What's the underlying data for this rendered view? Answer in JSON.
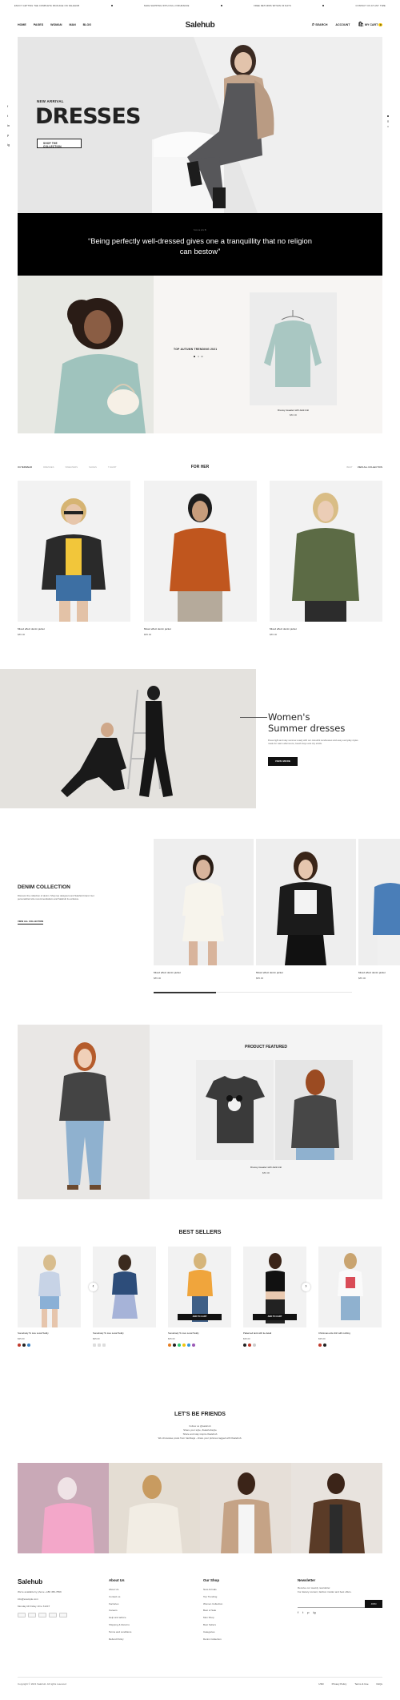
{
  "ticker": [
    "ENJOY GETTING THE COMPLETE PACKAGE ON SALEHUB",
    "SAFE SHIPPING WITH FULL INSURANCE",
    "FREE RETURNS WITHIN 30 DAYS",
    "CONTACT US AT ANY TIME"
  ],
  "header": {
    "logo": "Salehub",
    "menu": [
      "HOME",
      "PAGES",
      "WOMAN",
      "MAN",
      "BLOG"
    ],
    "search": "SEARCH",
    "account": "ACCOUNT",
    "cart": "MY CART",
    "cart_count": "0"
  },
  "social_icons": [
    "f",
    "t",
    "in",
    "p",
    "ig"
  ],
  "hero": {
    "subtitle": "NEW ARRIVAL",
    "title": "DRESSES",
    "button": "SHOP THE COLLECTION"
  },
  "quote": {
    "label": "SALEHUB",
    "text": "“Being perfectly well-dressed gives one a tranquillity that no religion can bestow”"
  },
  "trending": {
    "caption": "TOP AUTUMN TRENDING 2021",
    "product_name": "Dressy sweater with dark knit",
    "product_price": "$80.00"
  },
  "for_her": {
    "title": "FOR HER",
    "tabs": [
      "OUTERWEAR",
      "DRESSES",
      "SWEATERS",
      "SHOES",
      "T-SHIRT"
    ],
    "right_links": [
      "BEST",
      "VIEW ALL COLLECTION"
    ],
    "products": [
      {
        "name": "Mixed effect denim jacket",
        "price": "$85.00"
      },
      {
        "name": "Mixed effect denim jacket",
        "price": "$85.00"
      },
      {
        "name": "Mixed effect denim jacket",
        "price": "$85.00"
      }
    ]
  },
  "summer": {
    "title_line1": "Women's",
    "title_line2": "Summer dresses",
    "description": "Dress light and stay summer-ready with our colourful sundresses and easy everyday styles made for warm afternoons, beach days and city strolls.",
    "button": "VIEW MORE"
  },
  "denim": {
    "title": "DENIM COLLECTION",
    "description": "Discover the collection of denim. Shop top designers and Salehub brand. Get personalized size recommendations and Salehub & exclusive.",
    "link": "VIEW ALL COLLECTION",
    "products": [
      {
        "name": "Mixed effect denim jacket",
        "price": "$85.00"
      },
      {
        "name": "Mixed effect denim jacket",
        "price": "$85.00"
      },
      {
        "name": "Mixed effect denim jacket",
        "price": "$85.00"
      }
    ]
  },
  "featured": {
    "title": "PRODUCT FEATURED",
    "product_name": "Dressy sweater with dark knit",
    "product_price": "$80.00"
  },
  "best_sellers": {
    "title": "BEST SELLERS",
    "add_to_cart": "ADD TO CART",
    "products": [
      {
        "name": "Somebody To Live Local Teddy",
        "price": "$35.00"
      },
      {
        "name": "Somebody To Live Local Teddy",
        "price": "$35.00"
      },
      {
        "name": "Somebody To Live Local Teddy",
        "price": "$35.00"
      },
      {
        "name": "Patterned tank with tie detail",
        "price": "$35.00"
      },
      {
        "name": "Christmas arts shirt with nothing",
        "price": "$35.00"
      }
    ]
  },
  "friends": {
    "title": "LET'S BE FRIENDS",
    "lines": [
      "Follow us @salehub",
      "Share your style, #salehubstyle",
      "Share and stay inspire #salehub",
      "We showcase posts from hashtags - share your pictures tagged with #salehub."
    ]
  },
  "footer": {
    "logo": "Salehub",
    "contact": [
      "We're available by phone +180 456-7899",
      "info@example.com",
      "Monday till Friday 10 to 6 EST"
    ],
    "about_title": "About Us",
    "about_links": [
      "About Us",
      "Contact us",
      "Factories",
      "Careers",
      "Help and advice",
      "Shipping & Returns",
      "Terms and conditions",
      "Refund Policy"
    ],
    "shop_title": "Our Shop",
    "shop_links": [
      "New Arrivals",
      "Top Trending",
      "Women Collection",
      "Best of Sale",
      "Men Shop",
      "Best Sellers",
      "Categories",
      "Denim Collection"
    ],
    "newsletter_title": "Newsletter",
    "newsletter_text": [
      "Receive our weekly newsletter.",
      "For dietary content, fashion insider and best offers."
    ],
    "subscribe": "JOIN",
    "copyright": "Copyright © 2021 Salehub. All rights reserved",
    "bottom_links": [
      "USD",
      "Privacy Policy",
      "Terms & Use",
      "FAQs"
    ]
  }
}
